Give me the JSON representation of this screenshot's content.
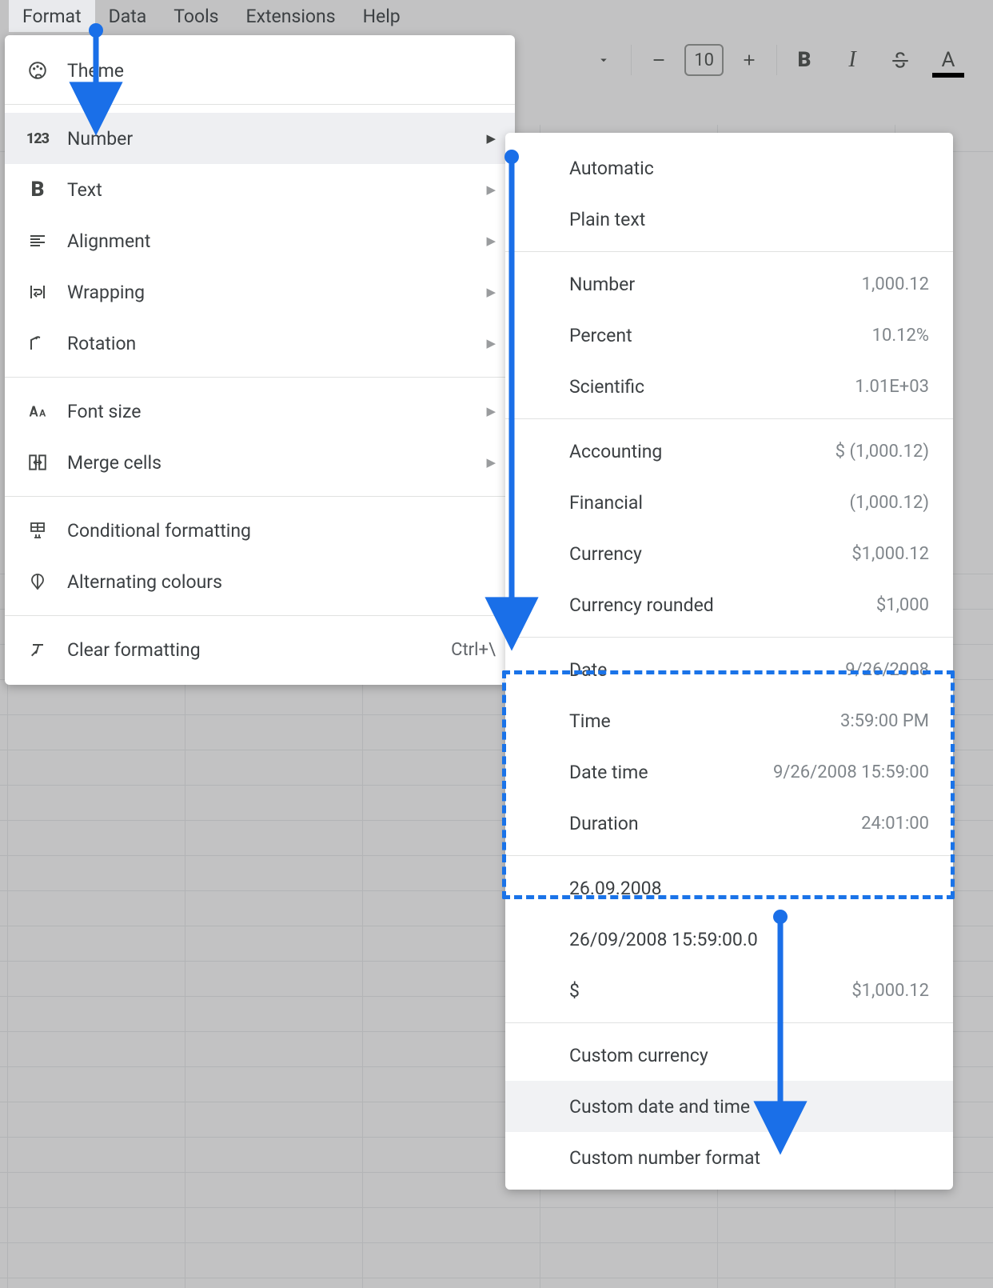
{
  "menubar": {
    "items": [
      {
        "label": "Format",
        "active": true
      },
      {
        "label": "Data"
      },
      {
        "label": "Tools"
      },
      {
        "label": "Extensions"
      },
      {
        "label": "Help"
      }
    ]
  },
  "toolbar": {
    "font_size_value": "10"
  },
  "format_menu": {
    "theme": "Theme",
    "number": "Number",
    "text": "Text",
    "alignment": "Alignment",
    "wrapping": "Wrapping",
    "rotation": "Rotation",
    "font_size": "Font size",
    "merge_cells": "Merge cells",
    "conditional_formatting": "Conditional formatting",
    "alternating_colours": "Alternating colours",
    "clear_formatting": "Clear formatting",
    "clear_formatting_shortcut": "Ctrl+\\"
  },
  "number_menu": {
    "automatic": "Automatic",
    "plain_text": "Plain text",
    "number_label": "Number",
    "number_sample": "1,000.12",
    "percent_label": "Percent",
    "percent_sample": "10.12%",
    "scientific_label": "Scientific",
    "scientific_sample": "1.01E+03",
    "accounting_label": "Accounting",
    "accounting_sample": "$ (1,000.12)",
    "financial_label": "Financial",
    "financial_sample": "(1,000.12)",
    "currency_label": "Currency",
    "currency_sample": "$1,000.12",
    "currency_rounded_label": "Currency rounded",
    "currency_rounded_sample": "$1,000",
    "date_label": "Date",
    "date_sample": "9/26/2008",
    "time_label": "Time",
    "time_sample": "3:59:00 PM",
    "datetime_label": "Date time",
    "datetime_sample": "9/26/2008 15:59:00",
    "duration_label": "Duration",
    "duration_sample": "24:01:00",
    "recent1_label": "26.09.2008",
    "recent2_label": "26/09/2008 15:59:00.0",
    "recent3_label": "$",
    "recent3_sample": "$1,000.12",
    "custom_currency": "Custom currency",
    "custom_date_time": "Custom date and time",
    "custom_number_format": "Custom number format"
  }
}
